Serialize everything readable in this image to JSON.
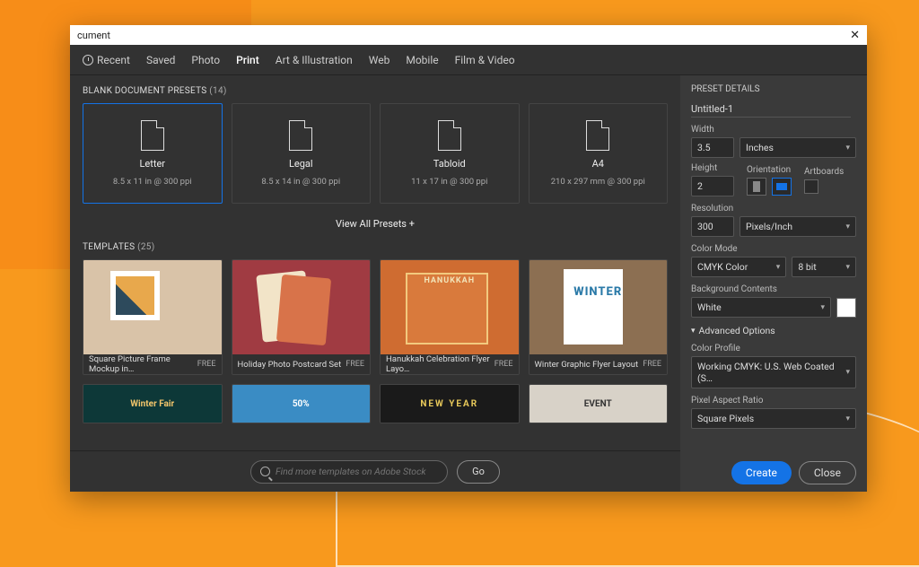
{
  "titlebar": {
    "title": "cument"
  },
  "tabs": {
    "items": [
      "Recent",
      "Saved",
      "Photo",
      "Print",
      "Art & Illustration",
      "Web",
      "Mobile",
      "Film & Video"
    ],
    "active": 3
  },
  "blankPresets": {
    "heading": "BLANK DOCUMENT PRESETS",
    "count": "(14)",
    "items": [
      {
        "name": "Letter",
        "spec": "8.5 x 11 in @ 300 ppi"
      },
      {
        "name": "Legal",
        "spec": "8.5 x 14 in @ 300 ppi"
      },
      {
        "name": "Tabloid",
        "spec": "11 x 17 in @ 300 ppi"
      },
      {
        "name": "A4",
        "spec": "210 x 297 mm @ 300 ppi"
      }
    ],
    "viewAll": "View All Presets +"
  },
  "templates": {
    "heading": "TEMPLATES",
    "count": "(25)",
    "freeLabel": "FREE",
    "items": [
      {
        "name": "Square Picture Frame Mockup in…"
      },
      {
        "name": "Holiday Photo Postcard Set"
      },
      {
        "name": "Hanukkah Celebration Flyer Layo…"
      },
      {
        "name": "Winter Graphic Flyer Layout"
      }
    ],
    "row2": [
      {
        "label": "Winter Fair"
      },
      {
        "label": "50%"
      },
      {
        "label": "NEW YEAR"
      },
      {
        "label": "EVENT"
      }
    ]
  },
  "search": {
    "placeholder": "Find more templates on Adobe Stock",
    "go": "Go"
  },
  "footer": {
    "create": "Create",
    "close": "Close"
  },
  "panel": {
    "heading": "PRESET DETAILS",
    "docName": "Untitled-1",
    "width": {
      "label": "Width",
      "value": "3.5",
      "unit": "Inches"
    },
    "height": {
      "label": "Height",
      "value": "2"
    },
    "orientation": {
      "label": "Orientation"
    },
    "artboards": {
      "label": "Artboards"
    },
    "resolution": {
      "label": "Resolution",
      "value": "300",
      "unit": "Pixels/Inch"
    },
    "colorMode": {
      "label": "Color Mode",
      "value": "CMYK Color",
      "bit": "8 bit"
    },
    "bg": {
      "label": "Background Contents",
      "value": "White"
    },
    "advanced": "Advanced Options",
    "colorProfile": {
      "label": "Color Profile",
      "value": "Working CMYK: U.S. Web Coated (S…"
    },
    "pixelAspect": {
      "label": "Pixel Aspect Ratio",
      "value": "Square Pixels"
    }
  }
}
